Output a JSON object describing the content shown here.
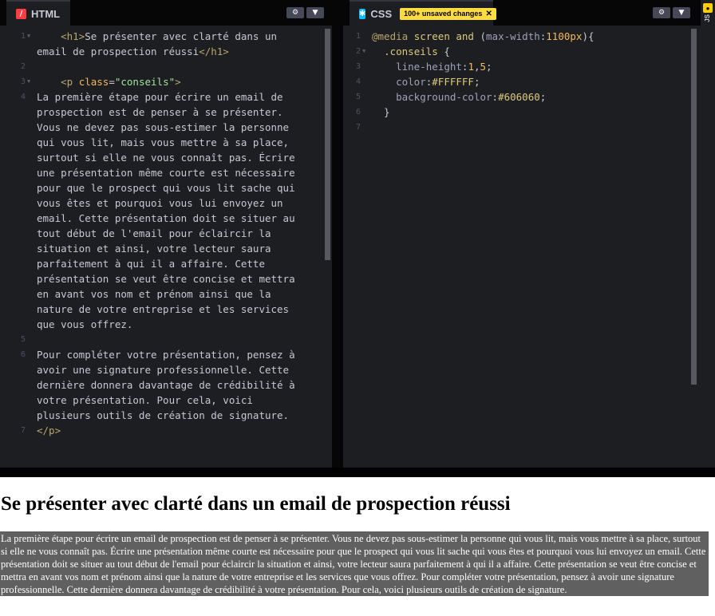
{
  "html_panel": {
    "tab_label": "HTML",
    "tab_icon": "slash-icon",
    "gutter": [
      "1",
      "",
      "",
      "3",
      "4",
      "",
      "",
      "",
      "",
      "",
      "",
      "",
      "",
      "",
      "",
      "",
      "",
      "",
      "",
      "",
      "",
      "6",
      "",
      "",
      "",
      "",
      "7"
    ],
    "lines": [
      [
        {
          "t": "    ",
          "c": "plain"
        },
        {
          "t": "<h1>",
          "c": "tg"
        },
        {
          "t": "Se présenter avec clarté dans un",
          "c": "plain"
        }
      ],
      [
        {
          "t": "email de prospection réussi",
          "c": "plain"
        },
        {
          "t": "</h1>",
          "c": "tg"
        }
      ],
      [],
      [
        {
          "t": "    ",
          "c": "plain"
        },
        {
          "t": "<p ",
          "c": "tg"
        },
        {
          "t": "class",
          "c": "at"
        },
        {
          "t": "=",
          "c": "plain"
        },
        {
          "t": "\"conseils\"",
          "c": "st"
        },
        {
          "t": ">",
          "c": "tg"
        }
      ],
      [
        {
          "t": "La première étape pour écrire un email de",
          "c": "plain"
        }
      ],
      [
        {
          "t": "prospection est de penser à se présenter.",
          "c": "plain"
        }
      ],
      [
        {
          "t": "Vous ne devez pas sous-estimer la personne",
          "c": "plain"
        }
      ],
      [
        {
          "t": "qui vous lit, mais vous mettre à sa place,",
          "c": "plain"
        }
      ],
      [
        {
          "t": "surtout si elle ne vous connaît pas. Écrire",
          "c": "plain"
        }
      ],
      [
        {
          "t": "une présentation même courte est nécessaire",
          "c": "plain"
        }
      ],
      [
        {
          "t": "pour que le prospect qui vous lit sache qui",
          "c": "plain"
        }
      ],
      [
        {
          "t": "vous êtes et pourquoi vous lui envoyez un",
          "c": "plain"
        }
      ],
      [
        {
          "t": "email. Cette présentation doit se situer au",
          "c": "plain"
        }
      ],
      [
        {
          "t": "tout début de l'email pour éclaircir la",
          "c": "plain"
        }
      ],
      [
        {
          "t": "situation et ainsi, votre lecteur saura",
          "c": "plain"
        }
      ],
      [
        {
          "t": "parfaitement à qui il a affaire. Cette",
          "c": "plain"
        }
      ],
      [
        {
          "t": "présentation se veut être concise et mettra",
          "c": "plain"
        }
      ],
      [
        {
          "t": "en avant vos nom et prénom ainsi que la",
          "c": "plain"
        }
      ],
      [
        {
          "t": "nature de votre entreprise et les services",
          "c": "plain"
        }
      ],
      [
        {
          "t": "que vous offrez.",
          "c": "plain"
        }
      ],
      [],
      [
        {
          "t": "Pour compléter votre présentation, pensez à",
          "c": "plain"
        }
      ],
      [
        {
          "t": "avoir une signature professionnelle. Cette",
          "c": "plain"
        }
      ],
      [
        {
          "t": "dernière donnera davantage de crédibilité à",
          "c": "plain"
        }
      ],
      [
        {
          "t": "votre présentation. Pour cela, voici",
          "c": "plain"
        }
      ],
      [
        {
          "t": "plusieurs outils de création de signature.",
          "c": "plain"
        }
      ],
      [
        {
          "t": "</p>",
          "c": "tg"
        }
      ]
    ],
    "gutter_numbers": [
      "1",
      "",
      "2",
      "3",
      "4",
      "",
      "",
      "",
      "",
      "",
      "",
      "",
      "",
      "",
      "",
      "",
      "",
      "",
      "",
      "",
      "5",
      "6",
      "",
      "",
      "",
      "",
      "7"
    ],
    "fold_lines": [
      0,
      3
    ]
  },
  "css_panel": {
    "tab_label": "CSS",
    "tab_icon": "asterisk-icon",
    "badge": "100+ unsaved changes",
    "gutter_numbers": [
      "1",
      "2",
      "3",
      "4",
      "5",
      "6",
      "7"
    ],
    "fold_lines": [
      1
    ],
    "lines": [
      [
        {
          "t": "@media ",
          "c": "tg"
        },
        {
          "t": "screen ",
          "c": "kw"
        },
        {
          "t": "and ",
          "c": "kw"
        },
        {
          "t": "(",
          "c": "plain"
        },
        {
          "t": "max-width",
          "c": "prop"
        },
        {
          "t": ":",
          "c": "plain"
        },
        {
          "t": "1100px",
          "c": "at"
        },
        {
          "t": "){",
          "c": "plain"
        }
      ],
      [
        {
          "t": "  ",
          "c": "plain"
        },
        {
          "t": ".conseils ",
          "c": "sel"
        },
        {
          "t": "{",
          "c": "plain"
        }
      ],
      [
        {
          "t": "    ",
          "c": "plain"
        },
        {
          "t": "line-height",
          "c": "prop"
        },
        {
          "t": ":",
          "c": "plain"
        },
        {
          "t": "1",
          "c": "at"
        },
        {
          "t": ",",
          "c": "plain"
        },
        {
          "t": "5",
          "c": "at"
        },
        {
          "t": ";",
          "c": "plain"
        }
      ],
      [
        {
          "t": "    ",
          "c": "plain"
        },
        {
          "t": "color",
          "c": "prop"
        },
        {
          "t": ":",
          "c": "plain"
        },
        {
          "t": "#FFFFFF",
          "c": "val"
        },
        {
          "t": ";",
          "c": "plain"
        }
      ],
      [
        {
          "t": "    ",
          "c": "plain"
        },
        {
          "t": "background-color",
          "c": "prop"
        },
        {
          "t": ":",
          "c": "plain"
        },
        {
          "t": "#606060",
          "c": "val"
        },
        {
          "t": ";",
          "c": "plain"
        }
      ],
      [
        {
          "t": "  }",
          "c": "plain"
        }
      ],
      []
    ]
  },
  "side_panel": {
    "label": "JS",
    "icon": "js-icon"
  },
  "preview": {
    "heading": "Se présenter avec clarté dans un email de prospection réussi",
    "paragraph": "La première étape pour écrire un email de prospection est de penser à se présenter. Vous ne devez pas sous-estimer la personne qui vous lit, mais vous mettre à sa place, surtout si elle ne vous connaît pas. Écrire une présentation même courte est nécessaire pour que le prospect qui vous lit sache qui vous êtes et pourquoi vous lui envoyez un email. Cette présentation doit se situer au tout début de l'email pour éclaircir la situation et ainsi, votre lecteur saura parfaitement à qui il a affaire. Cette présentation se veut être concise et mettra en avant vos nom et prénom ainsi que la nature de votre entreprise et les services que vous offrez. Pour compléter votre présentation, pensez à avoir une signature professionnelle. Cette dernière donnera davantage de crédibilité à votre présentation. Pour cela, voici plusieurs outils de création de signature."
  },
  "colors": {
    "editor_bg": "#1d1e22",
    "tab_bar_bg": "#060606",
    "badge_bg": "#ffdd40",
    "preview_paragraph_bg": "#606060",
    "html_icon": "#ff3c41",
    "css_icon": "#0ebeff"
  }
}
